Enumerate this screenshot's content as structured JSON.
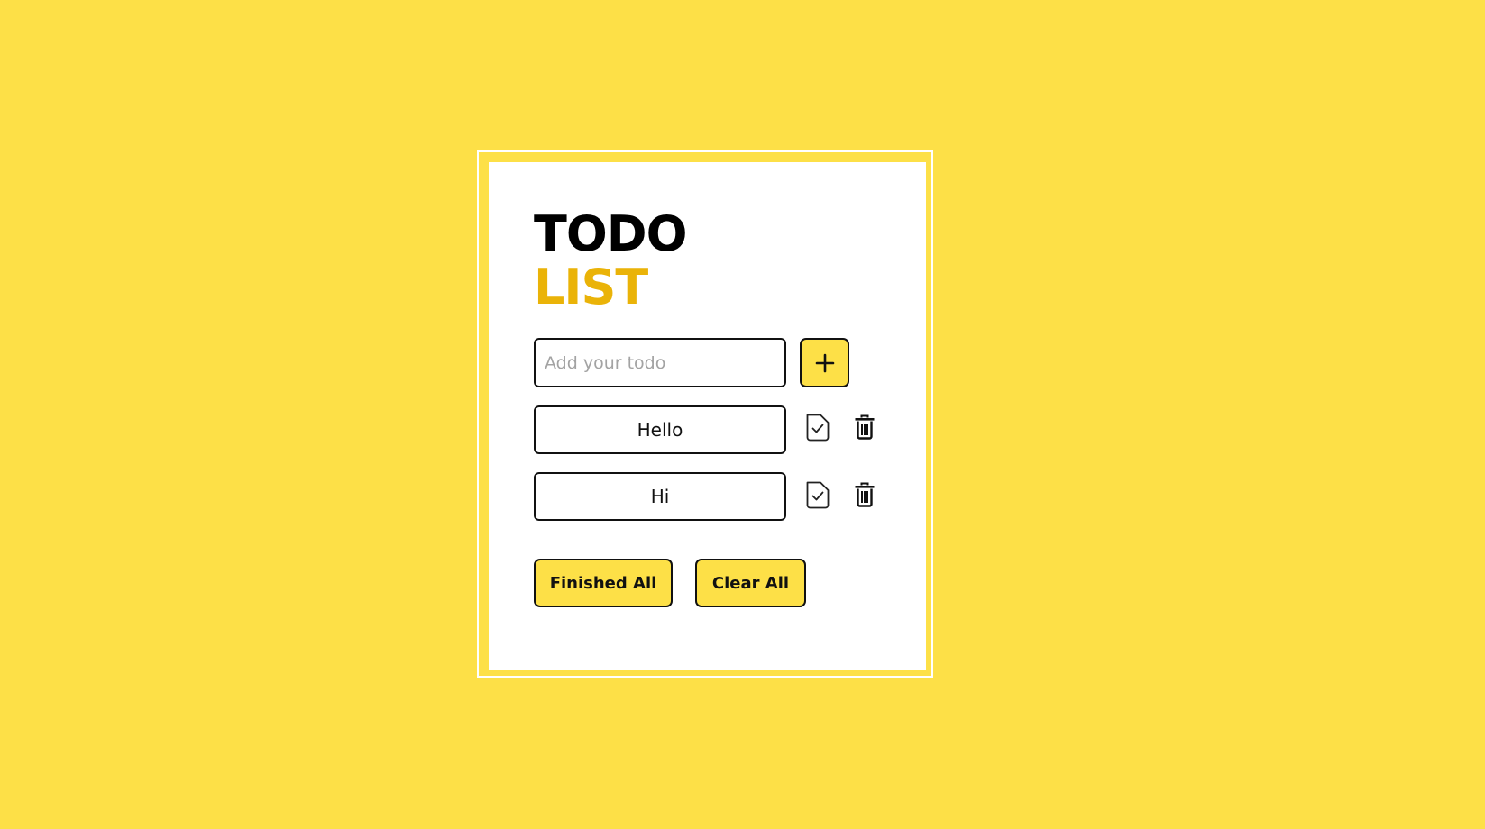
{
  "app": {
    "title_line1": "TODO",
    "title_line2": "LIST"
  },
  "new_todo": {
    "placeholder": "Add your todo",
    "value": "",
    "add_icon": "plus-icon"
  },
  "todos": [
    {
      "text": "Hello",
      "finish_icon": "check-file-icon",
      "delete_icon": "trash-icon"
    },
    {
      "text": "Hi",
      "finish_icon": "check-file-icon",
      "delete_icon": "trash-icon"
    }
  ],
  "actions": {
    "finished_all_label": "Finished All",
    "clear_all_label": "Clear All"
  },
  "colors": {
    "background": "#fde047",
    "accent": "#eab308",
    "card": "#ffffff",
    "border": "#111111"
  }
}
